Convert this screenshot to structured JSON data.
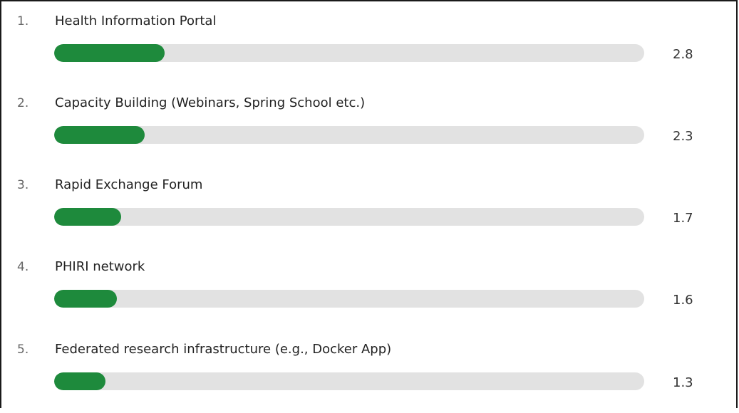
{
  "chart_data": {
    "type": "bar",
    "orientation": "horizontal",
    "categories": [
      "Health Information Portal",
      "Capacity Building (Webinars, Spring School etc.)",
      "Rapid Exchange Forum",
      "PHIRI network",
      "Federated research infrastructure (e.g., Docker App)"
    ],
    "ranks": [
      "1.",
      "2.",
      "3.",
      "4.",
      "5."
    ],
    "values": [
      2.8,
      2.3,
      1.7,
      1.6,
      1.3
    ],
    "value_labels": [
      "2.8",
      "2.3",
      "1.7",
      "1.6",
      "1.3"
    ],
    "xlim": [
      0,
      15
    ],
    "grid": false,
    "bar_color": "#1e8a3c",
    "track_color": "#e2e2e2"
  }
}
